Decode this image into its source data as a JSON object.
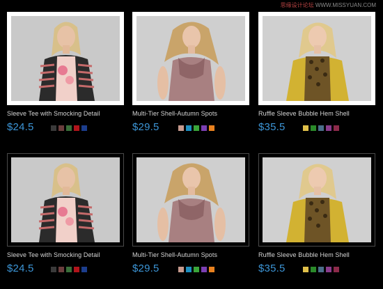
{
  "watermark": {
    "brand": "思缘设计论坛",
    "site": "WWW.MISSYUAN.COM"
  },
  "products": [
    {
      "name": "Sleeve Tee with Smocking Detail",
      "price": "$24.5",
      "figure": "model-cardigan",
      "swatches": [
        "#3a3a3a",
        "#6b3d3d",
        "#3a6e3a",
        "#b0141b",
        "#1c3d8c"
      ]
    },
    {
      "name": "Multi-Tier Shell-Autumn Spots",
      "price": "$29.5",
      "figure": "model-blush",
      "swatches": [
        "#c79a8e",
        "#1e8fc0",
        "#3aa53a",
        "#7b3fb2",
        "#e8811f"
      ]
    },
    {
      "name": "Ruffle Sleeve Bubble Hem Shell",
      "price": "$35.5",
      "figure": "model-mustard",
      "swatches": [
        "#e0c04a",
        "#2a8a2a",
        "#4a6e8a",
        "#8a3c8c",
        "#8c2a4a"
      ]
    },
    {
      "name": "Sleeve Tee with Smocking Detail",
      "price": "$24.5",
      "figure": "model-cardigan",
      "swatches": [
        "#3a3a3a",
        "#6b3d3d",
        "#3a6e3a",
        "#b0141b",
        "#1c3d8c"
      ]
    },
    {
      "name": "Multi-Tier Shell-Autumn Spots",
      "price": "$29.5",
      "figure": "model-blush",
      "swatches": [
        "#c79a8e",
        "#1e8fc0",
        "#3aa53a",
        "#7b3fb2",
        "#e8811f"
      ]
    },
    {
      "name": "Ruffle Sleeve Bubble Hem Shell",
      "price": "$35.5",
      "figure": "model-mustard",
      "swatches": [
        "#e0c04a",
        "#2a8a2a",
        "#4a6e8a",
        "#8a3c8c",
        "#8c2a4a"
      ]
    }
  ]
}
